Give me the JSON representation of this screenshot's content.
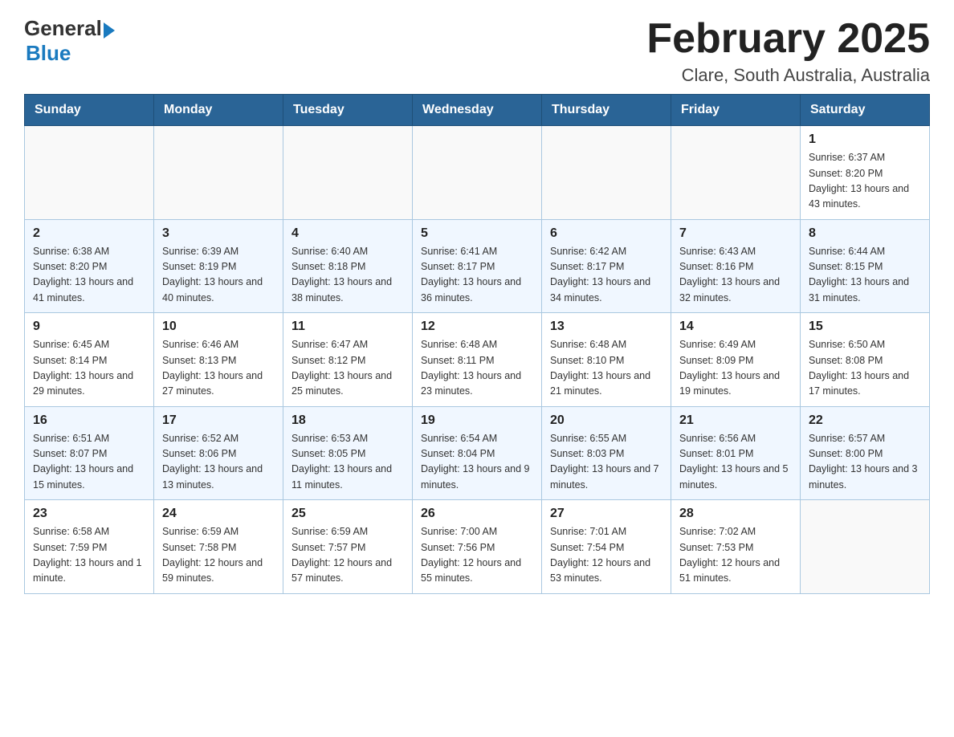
{
  "header": {
    "logo_general": "General",
    "logo_blue": "Blue",
    "month_title": "February 2025",
    "location": "Clare, South Australia, Australia"
  },
  "calendar": {
    "days_of_week": [
      "Sunday",
      "Monday",
      "Tuesday",
      "Wednesday",
      "Thursday",
      "Friday",
      "Saturday"
    ],
    "weeks": [
      [
        {
          "day": "",
          "info": ""
        },
        {
          "day": "",
          "info": ""
        },
        {
          "day": "",
          "info": ""
        },
        {
          "day": "",
          "info": ""
        },
        {
          "day": "",
          "info": ""
        },
        {
          "day": "",
          "info": ""
        },
        {
          "day": "1",
          "info": "Sunrise: 6:37 AM\nSunset: 8:20 PM\nDaylight: 13 hours and 43 minutes."
        }
      ],
      [
        {
          "day": "2",
          "info": "Sunrise: 6:38 AM\nSunset: 8:20 PM\nDaylight: 13 hours and 41 minutes."
        },
        {
          "day": "3",
          "info": "Sunrise: 6:39 AM\nSunset: 8:19 PM\nDaylight: 13 hours and 40 minutes."
        },
        {
          "day": "4",
          "info": "Sunrise: 6:40 AM\nSunset: 8:18 PM\nDaylight: 13 hours and 38 minutes."
        },
        {
          "day": "5",
          "info": "Sunrise: 6:41 AM\nSunset: 8:17 PM\nDaylight: 13 hours and 36 minutes."
        },
        {
          "day": "6",
          "info": "Sunrise: 6:42 AM\nSunset: 8:17 PM\nDaylight: 13 hours and 34 minutes."
        },
        {
          "day": "7",
          "info": "Sunrise: 6:43 AM\nSunset: 8:16 PM\nDaylight: 13 hours and 32 minutes."
        },
        {
          "day": "8",
          "info": "Sunrise: 6:44 AM\nSunset: 8:15 PM\nDaylight: 13 hours and 31 minutes."
        }
      ],
      [
        {
          "day": "9",
          "info": "Sunrise: 6:45 AM\nSunset: 8:14 PM\nDaylight: 13 hours and 29 minutes."
        },
        {
          "day": "10",
          "info": "Sunrise: 6:46 AM\nSunset: 8:13 PM\nDaylight: 13 hours and 27 minutes."
        },
        {
          "day": "11",
          "info": "Sunrise: 6:47 AM\nSunset: 8:12 PM\nDaylight: 13 hours and 25 minutes."
        },
        {
          "day": "12",
          "info": "Sunrise: 6:48 AM\nSunset: 8:11 PM\nDaylight: 13 hours and 23 minutes."
        },
        {
          "day": "13",
          "info": "Sunrise: 6:48 AM\nSunset: 8:10 PM\nDaylight: 13 hours and 21 minutes."
        },
        {
          "day": "14",
          "info": "Sunrise: 6:49 AM\nSunset: 8:09 PM\nDaylight: 13 hours and 19 minutes."
        },
        {
          "day": "15",
          "info": "Sunrise: 6:50 AM\nSunset: 8:08 PM\nDaylight: 13 hours and 17 minutes."
        }
      ],
      [
        {
          "day": "16",
          "info": "Sunrise: 6:51 AM\nSunset: 8:07 PM\nDaylight: 13 hours and 15 minutes."
        },
        {
          "day": "17",
          "info": "Sunrise: 6:52 AM\nSunset: 8:06 PM\nDaylight: 13 hours and 13 minutes."
        },
        {
          "day": "18",
          "info": "Sunrise: 6:53 AM\nSunset: 8:05 PM\nDaylight: 13 hours and 11 minutes."
        },
        {
          "day": "19",
          "info": "Sunrise: 6:54 AM\nSunset: 8:04 PM\nDaylight: 13 hours and 9 minutes."
        },
        {
          "day": "20",
          "info": "Sunrise: 6:55 AM\nSunset: 8:03 PM\nDaylight: 13 hours and 7 minutes."
        },
        {
          "day": "21",
          "info": "Sunrise: 6:56 AM\nSunset: 8:01 PM\nDaylight: 13 hours and 5 minutes."
        },
        {
          "day": "22",
          "info": "Sunrise: 6:57 AM\nSunset: 8:00 PM\nDaylight: 13 hours and 3 minutes."
        }
      ],
      [
        {
          "day": "23",
          "info": "Sunrise: 6:58 AM\nSunset: 7:59 PM\nDaylight: 13 hours and 1 minute."
        },
        {
          "day": "24",
          "info": "Sunrise: 6:59 AM\nSunset: 7:58 PM\nDaylight: 12 hours and 59 minutes."
        },
        {
          "day": "25",
          "info": "Sunrise: 6:59 AM\nSunset: 7:57 PM\nDaylight: 12 hours and 57 minutes."
        },
        {
          "day": "26",
          "info": "Sunrise: 7:00 AM\nSunset: 7:56 PM\nDaylight: 12 hours and 55 minutes."
        },
        {
          "day": "27",
          "info": "Sunrise: 7:01 AM\nSunset: 7:54 PM\nDaylight: 12 hours and 53 minutes."
        },
        {
          "day": "28",
          "info": "Sunrise: 7:02 AM\nSunset: 7:53 PM\nDaylight: 12 hours and 51 minutes."
        },
        {
          "day": "",
          "info": ""
        }
      ]
    ]
  }
}
